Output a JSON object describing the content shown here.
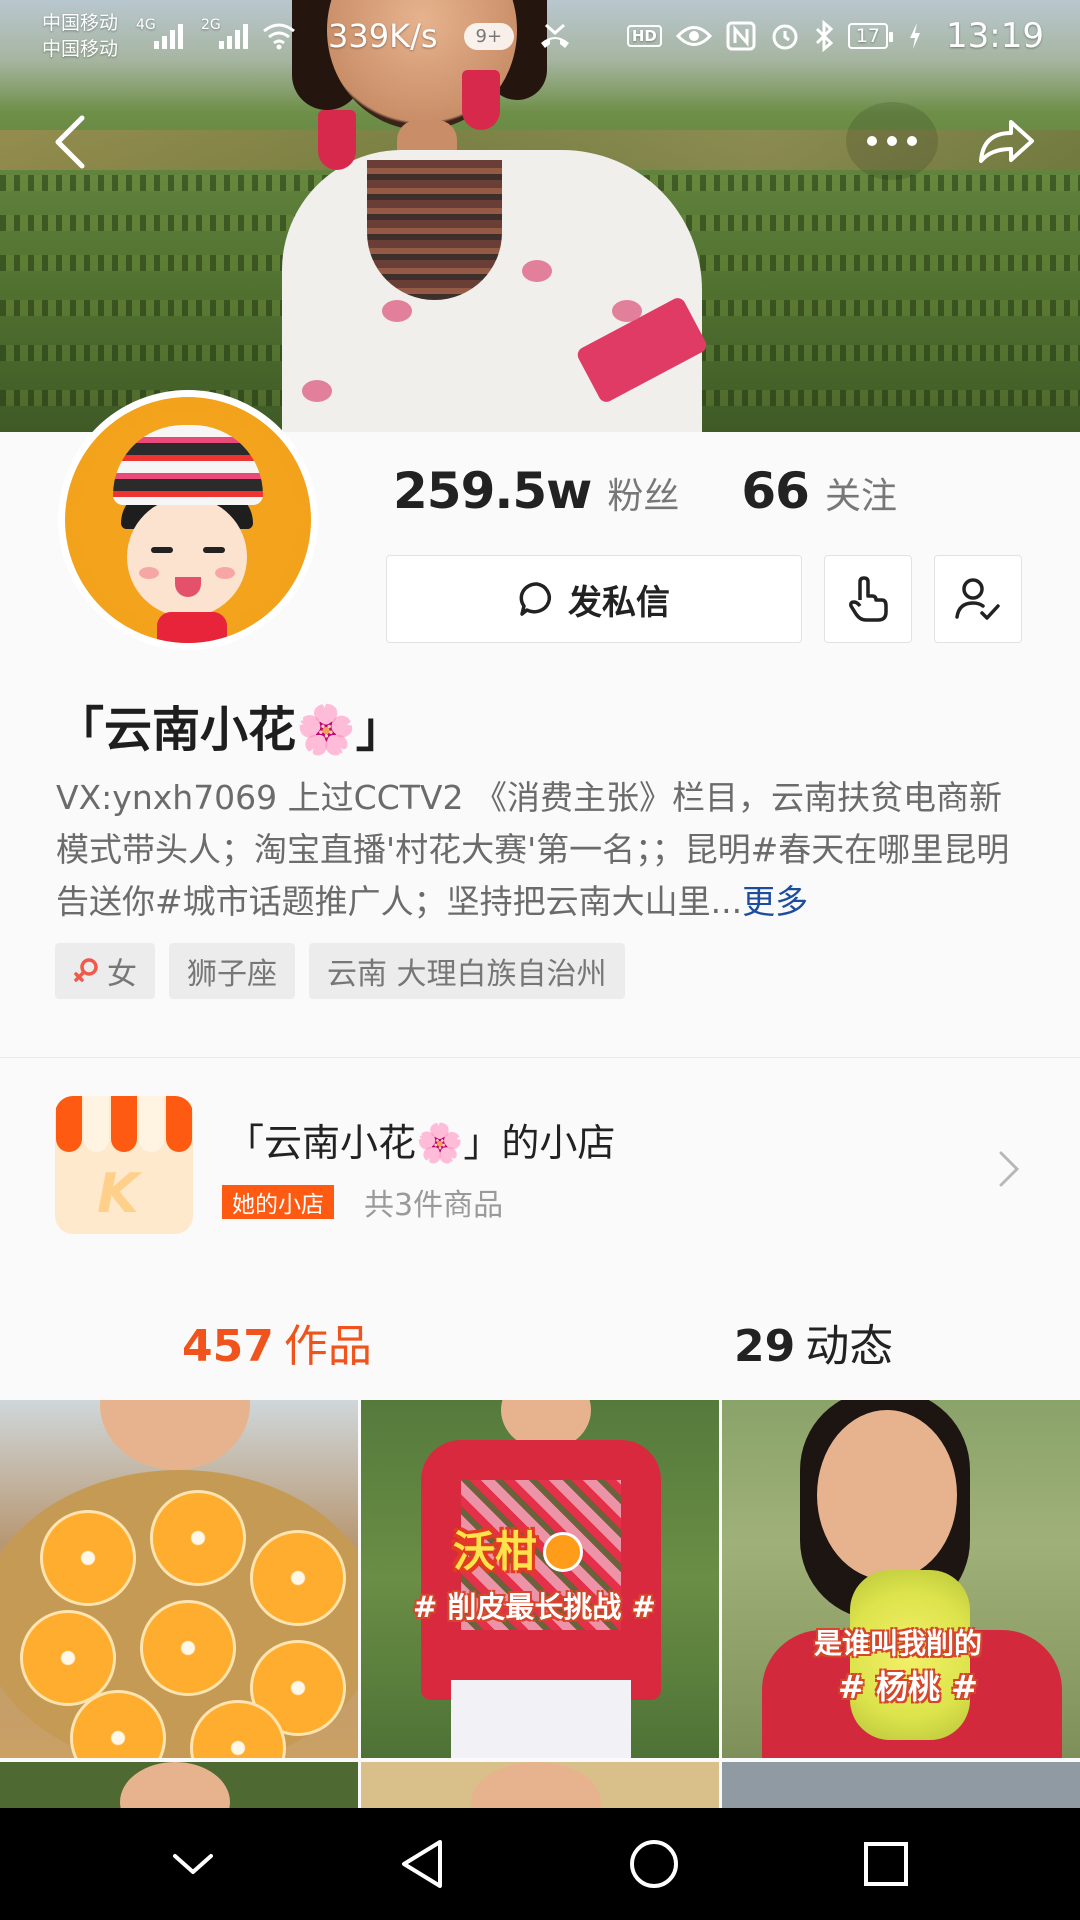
{
  "status_bar": {
    "carrier_1": "中国移动",
    "carrier_2": "中国移动",
    "network_1": "4G",
    "network_2": "2G",
    "speed": "339K/s",
    "notif_count": "9+",
    "hd": "HD",
    "battery": "17",
    "time": "13:19",
    "icons": [
      "signal-icon",
      "wifi-icon",
      "missed-call-icon",
      "eye-icon",
      "nfc-icon",
      "alarm-icon",
      "bluetooth-icon",
      "battery-icon",
      "charging-icon"
    ]
  },
  "topnav": {
    "icons": [
      "back-arrow-icon",
      "more-dots-icon",
      "share-icon"
    ]
  },
  "profile": {
    "followers_count": "259.5w",
    "followers_label": "粉丝",
    "following_count": "66",
    "following_label": "关注",
    "message_button": "发私信",
    "username": "「云南小花🌸」",
    "bio_text": "VX:ynxh7069 上过CCTV2 《消费主张》栏目，云南扶贫电商新模式带头人；淘宝直播'村花大赛'第一名；；昆明#春天在哪里昆明告送你#城市话题推广人；坚持把云南大山里...",
    "bio_more": "更多",
    "tags": [
      "女",
      "狮子座",
      "云南 大理白族自治州"
    ]
  },
  "store": {
    "name": "「云南小花🌸」的小店",
    "badge": "她的小店",
    "count": "共3件商品",
    "icon_letter": "K"
  },
  "tabs": {
    "works_count": "457",
    "works_label": "作品",
    "dynamics_count": "29",
    "dynamics_label": "动态"
  },
  "grid": {
    "video_2_title": "沃柑",
    "video_2_sub": "# 削皮最长挑战 #",
    "video_3_line1": "是谁叫我削的",
    "video_3_line2": "# 杨桃 #"
  },
  "colors": {
    "accent": "#f0541c",
    "link": "#1d4e9e",
    "store_orange": "#ff5a12"
  }
}
